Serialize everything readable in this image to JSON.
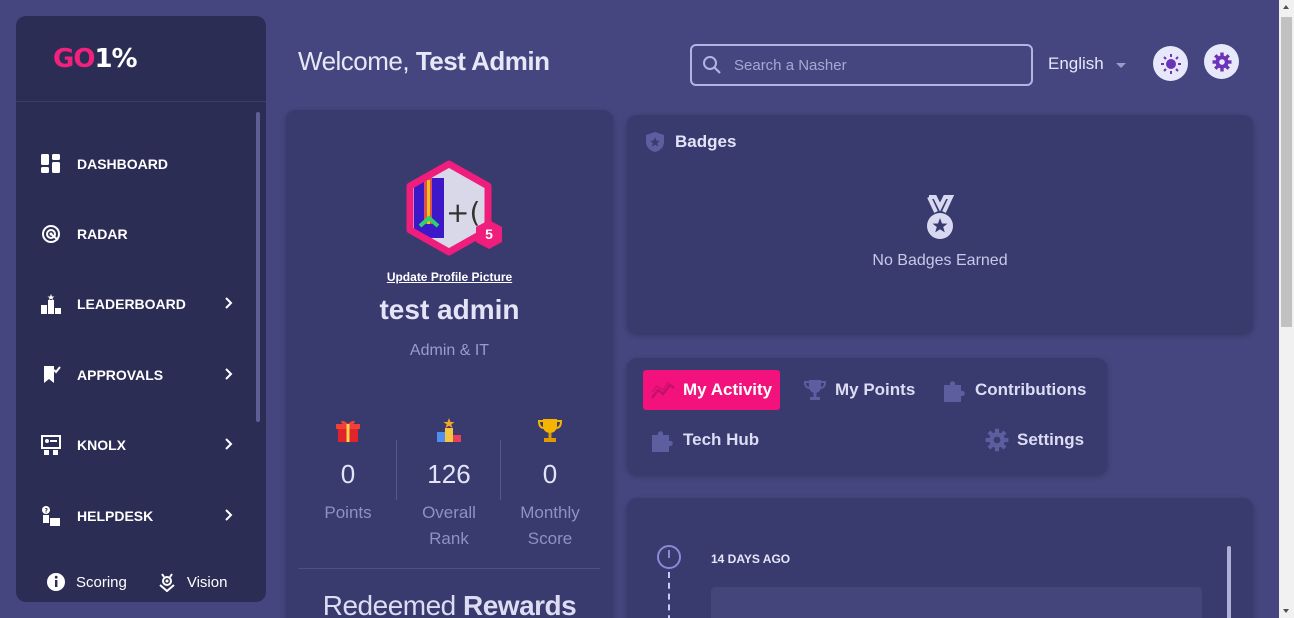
{
  "app": {
    "logo_go": "GO",
    "logo_one": "1%"
  },
  "sidebar": {
    "items": [
      {
        "label": "DASHBOARD",
        "icon": "dashboard-icon",
        "has_chevron": false
      },
      {
        "label": "RADAR",
        "icon": "radar-icon",
        "has_chevron": false
      },
      {
        "label": "LEADERBOARD",
        "icon": "podium-icon",
        "has_chevron": true
      },
      {
        "label": "APPROVALS",
        "icon": "bookmark-icon",
        "has_chevron": true
      },
      {
        "label": "KNOLX",
        "icon": "presentation-icon",
        "has_chevron": true
      },
      {
        "label": "HELPDESK",
        "icon": "help-desk-icon",
        "has_chevron": true
      }
    ],
    "footer": {
      "scoring": "Scoring",
      "vision": "Vision"
    }
  },
  "header": {
    "welcome_prefix": "Welcome,",
    "welcome_name": "Test Admin",
    "search_placeholder": "Search a Nasher",
    "language": "English"
  },
  "profile": {
    "level": "5",
    "update_picture": "Update Profile Picture",
    "name": "test admin",
    "role": "Admin & IT",
    "stats": [
      {
        "value": "0",
        "label": "Points",
        "icon": "gift-icon"
      },
      {
        "value": "126",
        "label": "Overall Rank",
        "icon": "podium-icon"
      },
      {
        "value": "0",
        "label": "Monthly Score",
        "icon": "trophy-icon"
      }
    ],
    "redeemed_light": "Redeemed",
    "redeemed_bold": "Rewards"
  },
  "badges": {
    "title": "Badges",
    "empty": "No Badges Earned"
  },
  "tabs": [
    {
      "label": "My Activity",
      "active": true
    },
    {
      "label": "My Points",
      "active": false
    },
    {
      "label": "Contributions",
      "active": false
    },
    {
      "label": "Tech Hub",
      "active": false
    },
    {
      "label": "Settings",
      "active": false
    }
  ],
  "activity": {
    "date": "14 DAYS AGO"
  },
  "colors": {
    "accent": "#f3127b",
    "background": "#45467f",
    "sidebar": "#2c2d55",
    "card": "#393a6e"
  }
}
